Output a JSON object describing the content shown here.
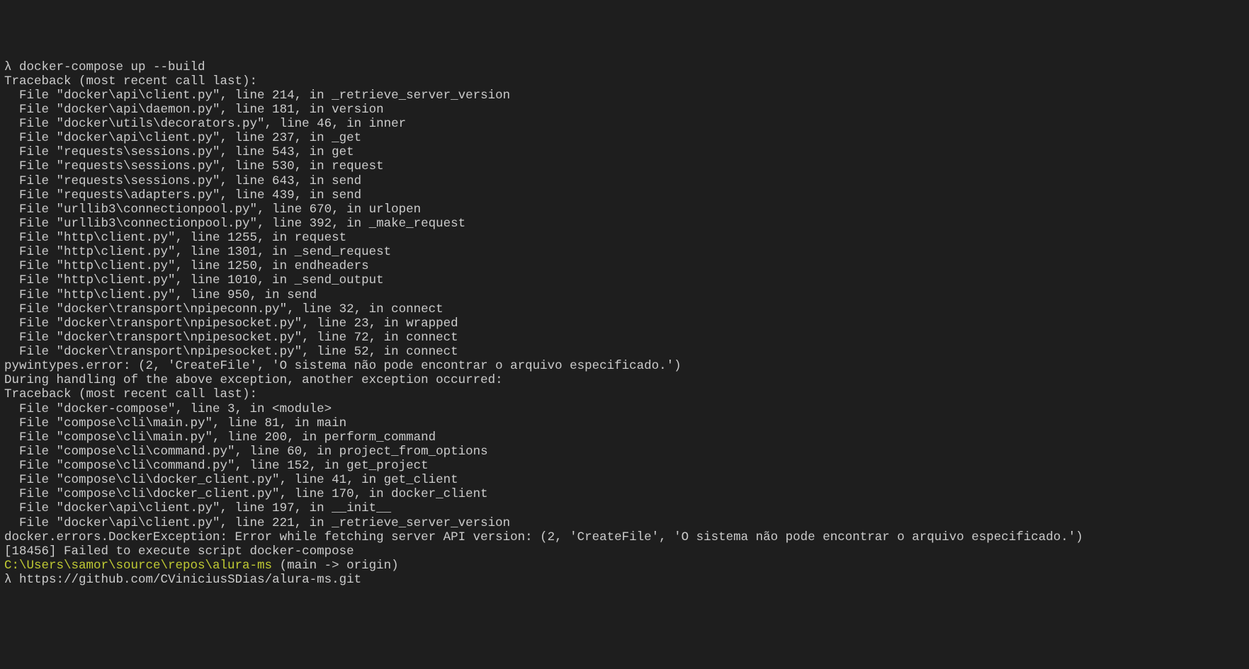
{
  "lines": [
    {
      "type": "prompt",
      "lambda": "λ ",
      "cmd": "docker-compose up --build"
    },
    {
      "type": "text",
      "content": "Traceback (most recent call last):"
    },
    {
      "type": "text",
      "content": "  File \"docker\\api\\client.py\", line 214, in _retrieve_server_version"
    },
    {
      "type": "text",
      "content": "  File \"docker\\api\\daemon.py\", line 181, in version"
    },
    {
      "type": "text",
      "content": "  File \"docker\\utils\\decorators.py\", line 46, in inner"
    },
    {
      "type": "text",
      "content": "  File \"docker\\api\\client.py\", line 237, in _get"
    },
    {
      "type": "text",
      "content": "  File \"requests\\sessions.py\", line 543, in get"
    },
    {
      "type": "text",
      "content": "  File \"requests\\sessions.py\", line 530, in request"
    },
    {
      "type": "text",
      "content": "  File \"requests\\sessions.py\", line 643, in send"
    },
    {
      "type": "text",
      "content": "  File \"requests\\adapters.py\", line 439, in send"
    },
    {
      "type": "text",
      "content": "  File \"urllib3\\connectionpool.py\", line 670, in urlopen"
    },
    {
      "type": "text",
      "content": "  File \"urllib3\\connectionpool.py\", line 392, in _make_request"
    },
    {
      "type": "text",
      "content": "  File \"http\\client.py\", line 1255, in request"
    },
    {
      "type": "text",
      "content": "  File \"http\\client.py\", line 1301, in _send_request"
    },
    {
      "type": "text",
      "content": "  File \"http\\client.py\", line 1250, in endheaders"
    },
    {
      "type": "text",
      "content": "  File \"http\\client.py\", line 1010, in _send_output"
    },
    {
      "type": "text",
      "content": "  File \"http\\client.py\", line 950, in send"
    },
    {
      "type": "text",
      "content": "  File \"docker\\transport\\npipeconn.py\", line 32, in connect"
    },
    {
      "type": "text",
      "content": "  File \"docker\\transport\\npipesocket.py\", line 23, in wrapped"
    },
    {
      "type": "text",
      "content": "  File \"docker\\transport\\npipesocket.py\", line 72, in connect"
    },
    {
      "type": "text",
      "content": "  File \"docker\\transport\\npipesocket.py\", line 52, in connect"
    },
    {
      "type": "text",
      "content": "pywintypes.error: (2, 'CreateFile', 'O sistema não pode encontrar o arquivo especificado.')"
    },
    {
      "type": "text",
      "content": ""
    },
    {
      "type": "text",
      "content": "During handling of the above exception, another exception occurred:"
    },
    {
      "type": "text",
      "content": ""
    },
    {
      "type": "text",
      "content": "Traceback (most recent call last):"
    },
    {
      "type": "text",
      "content": "  File \"docker-compose\", line 3, in <module>"
    },
    {
      "type": "text",
      "content": "  File \"compose\\cli\\main.py\", line 81, in main"
    },
    {
      "type": "text",
      "content": "  File \"compose\\cli\\main.py\", line 200, in perform_command"
    },
    {
      "type": "text",
      "content": "  File \"compose\\cli\\command.py\", line 60, in project_from_options"
    },
    {
      "type": "text",
      "content": "  File \"compose\\cli\\command.py\", line 152, in get_project"
    },
    {
      "type": "text",
      "content": "  File \"compose\\cli\\docker_client.py\", line 41, in get_client"
    },
    {
      "type": "text",
      "content": "  File \"compose\\cli\\docker_client.py\", line 170, in docker_client"
    },
    {
      "type": "text",
      "content": "  File \"docker\\api\\client.py\", line 197, in __init__"
    },
    {
      "type": "text",
      "content": "  File \"docker\\api\\client.py\", line 221, in _retrieve_server_version"
    },
    {
      "type": "text",
      "content": "docker.errors.DockerException: Error while fetching server API version: (2, 'CreateFile', 'O sistema não pode encontrar o arquivo especificado.')"
    },
    {
      "type": "text",
      "content": "[18456] Failed to execute script docker-compose"
    },
    {
      "type": "text",
      "content": ""
    }
  ],
  "path_line": {
    "path": "C:\\Users\\samor\\source\\repos\\alura-ms",
    "branch": " (main -> origin)"
  },
  "last_prompt": {
    "lambda": "λ ",
    "cmd": "https://github.com/CViniciusSDias/alura-ms.git"
  }
}
